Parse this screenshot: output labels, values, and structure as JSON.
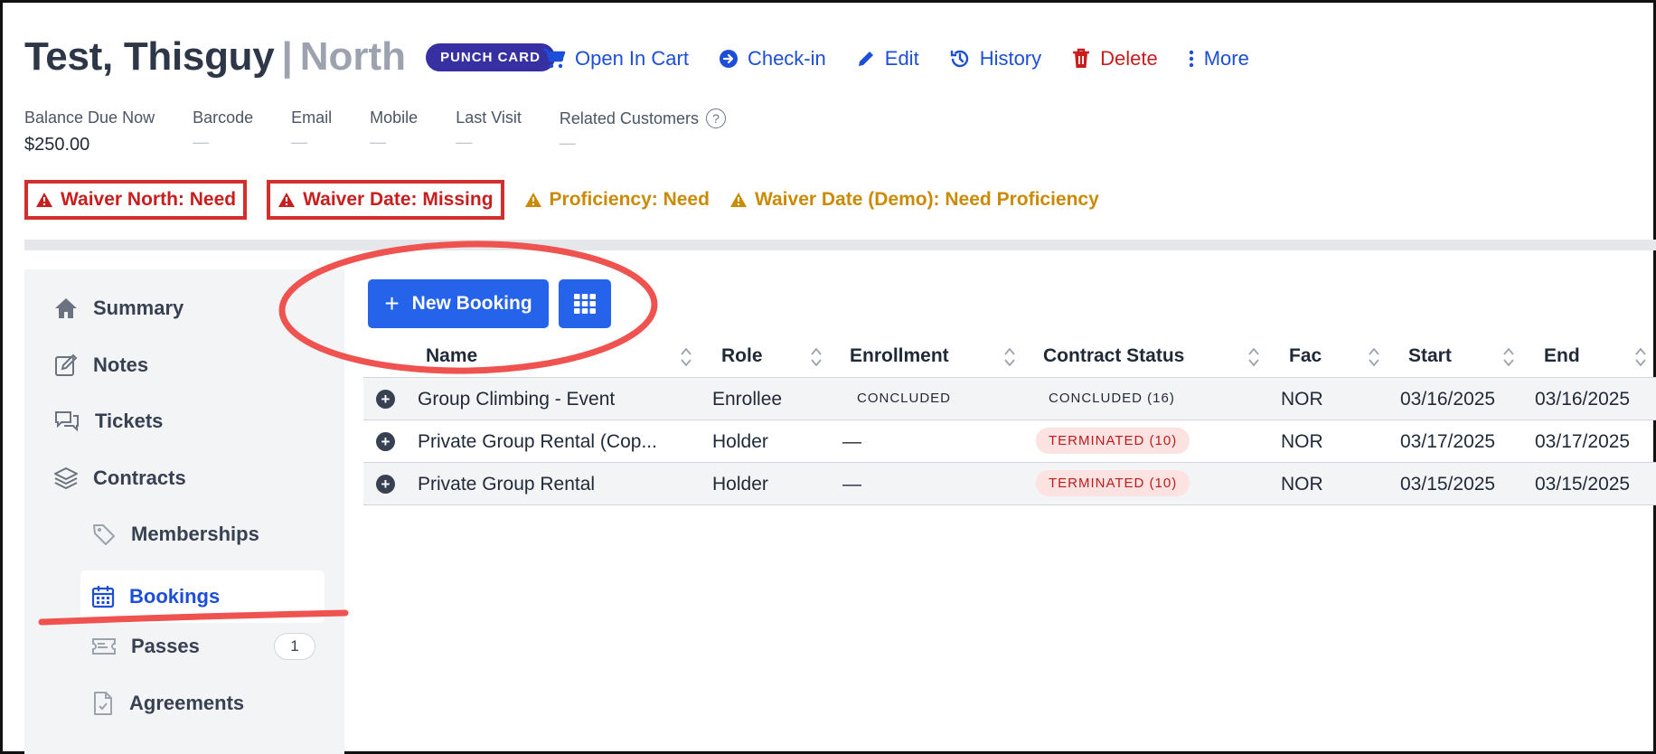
{
  "header": {
    "name": "Test, Thisguy",
    "separator": "|",
    "location": "North",
    "badge": "PUNCH CARD",
    "actions": [
      {
        "label": "Open In Cart",
        "icon": "cart-icon"
      },
      {
        "label": "Check-in",
        "icon": "arrow-circle-icon"
      },
      {
        "label": "Edit",
        "icon": "pencil-icon"
      },
      {
        "label": "History",
        "icon": "history-icon"
      },
      {
        "label": "Delete",
        "icon": "trash-icon"
      },
      {
        "label": "More",
        "icon": "more-vertical-icon"
      }
    ]
  },
  "info": {
    "balance_label": "Balance Due Now",
    "balance_value": "$250.00",
    "barcode_label": "Barcode",
    "email_label": "Email",
    "mobile_label": "Mobile",
    "last_visit_label": "Last Visit",
    "related_label": "Related Customers",
    "help_icon": "?",
    "empty_value": "—"
  },
  "alerts": [
    {
      "text": "Waiver North: Need",
      "level": "error"
    },
    {
      "text": "Waiver Date: Missing",
      "level": "error"
    },
    {
      "text": "Proficiency: Need",
      "level": "warning"
    },
    {
      "text": "Waiver Date (Demo): Need Proficiency",
      "level": "warning"
    }
  ],
  "sidebar": {
    "items": [
      {
        "label": "Summary",
        "icon": "home-icon"
      },
      {
        "label": "Notes",
        "icon": "edit-note-icon"
      },
      {
        "label": "Tickets",
        "icon": "chat-icon"
      },
      {
        "label": "Contracts",
        "icon": "layers-icon"
      },
      {
        "label": "Memberships",
        "icon": "tag-icon"
      },
      {
        "label": "Bookings",
        "icon": "calendar-icon"
      },
      {
        "label": "Passes",
        "icon": "ticket-icon",
        "count": "1"
      },
      {
        "label": "Agreements",
        "icon": "document-icon"
      }
    ]
  },
  "toolbar": {
    "new_booking_label": "New Booking",
    "plus": "+",
    "grid_icon": "grid-icon"
  },
  "table": {
    "columns": [
      "Name",
      "Role",
      "Enrollment",
      "Contract Status",
      "Fac",
      "Start",
      "End"
    ],
    "rows": [
      {
        "name": "Group Climbing - Event",
        "role": "Enrollee",
        "enrollment": "CONCLUDED",
        "status": "CONCLUDED (16)",
        "status_color": "gray",
        "fac": "NOR",
        "start": "03/16/2025",
        "end": "03/16/2025"
      },
      {
        "name": "Private Group Rental (Cop...",
        "role": "Holder",
        "enrollment": "—",
        "status": "TERMINATED (10)",
        "status_color": "red",
        "fac": "NOR",
        "start": "03/17/2025",
        "end": "03/17/2025"
      },
      {
        "name": "Private Group Rental",
        "role": "Holder",
        "enrollment": "—",
        "status": "TERMINATED (10)",
        "status_color": "red",
        "fac": "NOR",
        "start": "03/15/2025",
        "end": "03/15/2025"
      }
    ],
    "expander": "+"
  },
  "colors": {
    "accent": "#2563eb",
    "error": "#c81e1e",
    "warning": "#ca8a04",
    "annotation": "#ef5350"
  }
}
